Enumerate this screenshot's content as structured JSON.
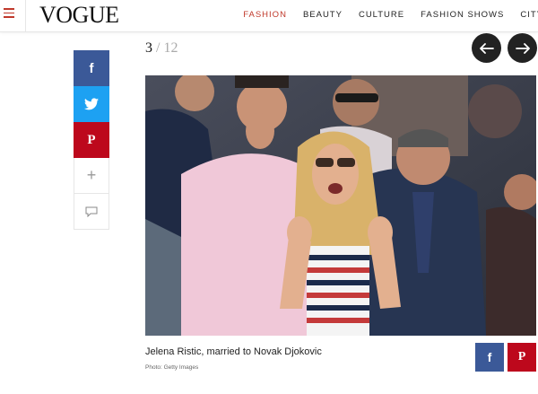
{
  "header": {
    "logo": "VOGUE",
    "nav": [
      "FASHION",
      "BEAUTY",
      "CULTURE",
      "FASHION SHOWS",
      "CITY"
    ]
  },
  "share_rail": {
    "facebook": "f",
    "pinterest": "P",
    "more": "+",
    "icons": [
      "facebook-icon",
      "twitter-icon",
      "pinterest-icon",
      "plus-icon",
      "comment-icon"
    ]
  },
  "gallery": {
    "current": "3",
    "separator": "/",
    "total": "12"
  },
  "slide": {
    "caption": "Jelena Ristic, married to Novak Djokovic",
    "credit": "Photo: Getty Images"
  },
  "caption_share": {
    "facebook": "f",
    "pinterest": "P"
  },
  "colors": {
    "accent": "#c0392b",
    "facebook": "#3b5998",
    "twitter": "#1da1f2",
    "pinterest": "#bd081c",
    "arrow_bg": "#222222"
  }
}
